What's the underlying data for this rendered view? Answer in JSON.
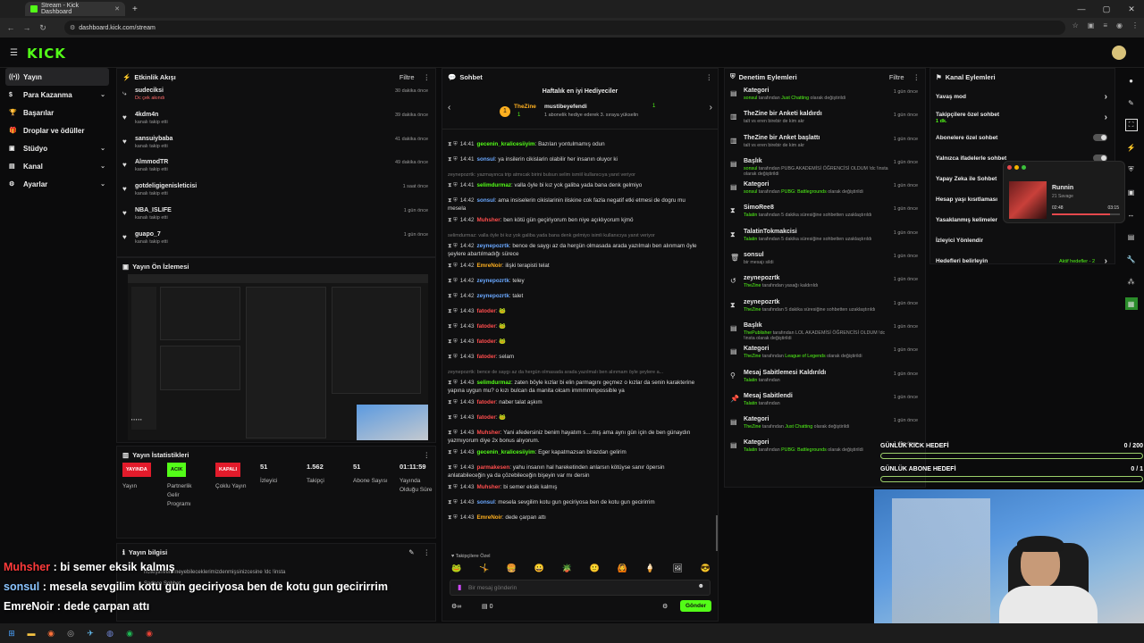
{
  "browser": {
    "tab_title": "Stream - Kick Dashboard",
    "new_tab": "+",
    "url": "dashboard.kick.com/stream"
  },
  "brand": {
    "logo": "KICK"
  },
  "sidebar": {
    "items": [
      {
        "label": "Yayın",
        "icon": "broadcast-icon",
        "chev": ""
      },
      {
        "label": "Para Kazanma",
        "icon": "money-icon",
        "chev": "⌄"
      },
      {
        "label": "Başarılar",
        "icon": "trophy-icon",
        "chev": ""
      },
      {
        "label": "Droplar ve ödüller",
        "icon": "gift-icon",
        "chev": ""
      },
      {
        "label": "Stüdyo",
        "icon": "studio-icon",
        "chev": "⌄"
      },
      {
        "label": "Kanal",
        "icon": "channel-icon",
        "chev": "⌄"
      },
      {
        "label": "Ayarlar",
        "icon": "settings-icon",
        "chev": "⌄"
      }
    ]
  },
  "activity": {
    "title": "Etkinlik Akışı",
    "filter": "Filtre",
    "items": [
      {
        "name": "sudeciksi",
        "sub": "Dc çek akındı",
        "time": "30 dakika önce",
        "icon": "share-icon"
      },
      {
        "name": "4kdm4n",
        "sub": "kanalı takip etti",
        "time": "39 dakika önce",
        "icon": "heart-icon"
      },
      {
        "name": "sansuiybaba",
        "sub": "kanalı takip etti",
        "time": "41 dakika önce",
        "icon": "heart-icon"
      },
      {
        "name": "AlmmodTR",
        "sub": "kanalı takip etti",
        "time": "49 dakika önce",
        "icon": "heart-icon"
      },
      {
        "name": "gotdeligigenisleticisi",
        "sub": "kanalı takip etti",
        "time": "1 saat önce",
        "icon": "heart-icon"
      },
      {
        "name": "NBA_ISLIFE",
        "sub": "kanalı takip etti",
        "time": "1 gün önce",
        "icon": "heart-icon"
      },
      {
        "name": "guapo_7",
        "sub": "kanalı takip etti",
        "time": "1 gün önce",
        "icon": "heart-icon"
      }
    ]
  },
  "preview": {
    "title": "Yayın Ön İzlemesi"
  },
  "stats": {
    "title": "Yayın İstatistikleri",
    "yayin_badge": "YAYINDA",
    "yayin_label": "Yayın",
    "partner_badge": "ACIK",
    "partner_label": "Partnerlik Gelir Programı",
    "multi_badge": "KAPALI",
    "multi_label": "Çoklu Yayın",
    "viewers": "51",
    "viewers_label": "İzleyici",
    "followers": "1.562",
    "followers_label": "Takipçi",
    "subs": "51",
    "subs_label": "Abone Sayısı",
    "uptime": "01:11:59",
    "uptime_label": "Yayında Olduğu Süre"
  },
  "info": {
    "title": "Yayın bilgisi"
  },
  "chat": {
    "title": "Sohbet",
    "gifters_title": "Haftalık en iyi Hediyeciler",
    "g1_name": "TheZine",
    "g1_count": "1",
    "g2_name": "mustibeyefendi",
    "g2_count": "1",
    "g2_note": "1 abonelik hediye ederek 3. sıraya yükselin",
    "input_placeholder": "Bir mesaj gönderin",
    "send": "Gönder",
    "followers_only": "Takipçilere Özel",
    "points": "0",
    "lines": [
      {
        "t": "14:41",
        "u": "gecenin_kralicesiiyim",
        "uc": "#53fc18",
        "m": ": Bazıları yontulmamış odun",
        "d": ""
      },
      {
        "t": "14:41",
        "u": "sonsul",
        "uc": "#6aa8ff",
        "m": ": ya insilerin cikislarin olabilir her insanın oluyor ki",
        "d": ""
      },
      {
        "t": "",
        "u": "",
        "uc": "",
        "m": "",
        "d": "zeynepozrtk: yazmayınca trip atmıcak birini bulsun selim ismiil kullanıcıya yanıt veriyor"
      },
      {
        "t": "14:41",
        "u": "selimdurmaz",
        "uc": "#53fc18",
        "m": ": valla öyle bi kız yok galiba yada bana denk gelmiyo",
        "d": ""
      },
      {
        "t": "14:42",
        "u": "sonsul",
        "uc": "#6aa8ff",
        "m": ": ama insiselerin cikislarinin iliskine cok fazla negatif etki etmesi de dogru mu mesela",
        "d": ""
      },
      {
        "t": "14:42",
        "u": "Muhsher",
        "uc": "#ff4d4d",
        "m": ": ben kötü gün geçiriyorum ben niye açıklıyorum kjmö",
        "d": ""
      },
      {
        "t": "",
        "u": "",
        "uc": "",
        "m": "",
        "d": "selimdurmaz: valla öyle bi kız yok galiba yada bana denk gelmiyo isimli kullanıcıya yanıt veriyor"
      },
      {
        "t": "14:42",
        "u": "zeynepozrtk",
        "uc": "#6aa8ff",
        "m": ": bence de saygı az da hergün olmasada arada yazılmalı ben alınmam öyle şeylere abartılmadığı sürece",
        "d": ""
      },
      {
        "t": "14:42",
        "u": "EmreNoir",
        "uc": "#ffb020",
        "m": ": ilişki terapisti telat",
        "d": ""
      },
      {
        "t": "14:42",
        "u": "zeynepozrtk",
        "uc": "#6aa8ff",
        "m": ": teley",
        "d": ""
      },
      {
        "t": "14:42",
        "u": "zeynepozrtk",
        "uc": "#6aa8ff",
        "m": ": talet",
        "d": ""
      },
      {
        "t": "14:43",
        "u": "fatoder",
        "uc": "#ff4d4d",
        "m": ": 🐸",
        "d": ""
      },
      {
        "t": "14:43",
        "u": "fatoder",
        "uc": "#ff4d4d",
        "m": ": 🐸",
        "d": ""
      },
      {
        "t": "14:43",
        "u": "fatoder",
        "uc": "#ff4d4d",
        "m": ": 🐸",
        "d": ""
      },
      {
        "t": "14:43",
        "u": "fatoder",
        "uc": "#ff4d4d",
        "m": ": selam",
        "d": ""
      },
      {
        "t": "",
        "u": "",
        "uc": "",
        "m": "",
        "d": "zeynepozrtk: bence de saygı az da hergün olmasada arada yazılmalı ben alınmam öyle şeylere a..."
      },
      {
        "t": "14:43",
        "u": "selimdurmaz",
        "uc": "#53fc18",
        "m": ": zaten böyle kızlar bi elin parmagını geçmez o kızlar da senin karakterine yapına uygun mu? o kızı bulcan da manita olcam immmmmpossible ya",
        "d": ""
      },
      {
        "t": "14:43",
        "u": "fatoder",
        "uc": "#ff4d4d",
        "m": ": naber talat aşkım",
        "d": ""
      },
      {
        "t": "14:43",
        "u": "fatoder",
        "uc": "#ff4d4d",
        "m": ": 🐸",
        "d": ""
      },
      {
        "t": "14:43",
        "u": "Muhsher",
        "uc": "#ff4d4d",
        "m": ": Yani afedersiniz benim hayatım s....mış ama aynı gün için de ben günaydın yazmıyorum diye 2x bonus alıyorum.",
        "d": ""
      },
      {
        "t": "14:43",
        "u": "gecenin_kralicesiiyim",
        "uc": "#53fc18",
        "m": ": Eger kapatmazsan birazdan gelirim",
        "d": ""
      },
      {
        "t": "14:43",
        "u": "parmakesen",
        "uc": "#ff4d4d",
        "m": ": yahu insanın hal hareketinden anlarsın kötüyse sanır öpersin anlatabileceğin ya da çözebileceğin bişeyin var mı dersin",
        "d": ""
      },
      {
        "t": "14:43",
        "u": "Muhsher",
        "uc": "#ff4d4d",
        "m": ": bi semer eksik kalmış",
        "d": ""
      },
      {
        "t": "14:43",
        "u": "sonsul",
        "uc": "#6aa8ff",
        "m": ": mesela sevgilim kotu gun geciriyosa ben de kotu gun gecirirrim",
        "d": ""
      },
      {
        "t": "14:43",
        "u": "EmreNoir",
        "uc": "#ffb020",
        "m": ": dede çarpan attı",
        "d": ""
      }
    ]
  },
  "mod": {
    "title": "Denetim Eylemleri",
    "filter": "Filtre",
    "items": [
      {
        "name": "Kategori",
        "sub1": "sonsul",
        "sub2": " tarafından ",
        "hl": "Just Chatting",
        "sub3": " olarak değiştirildi",
        "time": "1 gün önce",
        "icon": "category-icon"
      },
      {
        "name": "TheZine bir Anketi kaldırdı",
        "sub1": "",
        "sub2": "talt vs eren birebir de kim akr",
        "hl": "",
        "sub3": "",
        "time": "1 gün önce",
        "icon": "poll-icon"
      },
      {
        "name": "TheZine bir Anket başlattı",
        "sub1": "",
        "sub2": "talt vs eren birebir de kim akr",
        "hl": "",
        "sub3": "",
        "time": "1 gün önce",
        "icon": "poll-icon"
      },
      {
        "name": "Başlık",
        "sub1": "sonsul",
        "sub2": " tarafından PUBG AKADEMİSİ ÖĞRENCİSİ OLDUM !dc !insta olarak değiştirildi",
        "hl": "",
        "sub3": "",
        "time": "1 gün önce",
        "icon": "title-icon"
      },
      {
        "name": "Kategori",
        "sub1": "sonsul",
        "sub2": " tarafından ",
        "hl": "PUBG: Battlegrounds",
        "sub3": " olarak değiştirildi",
        "time": "1 gün önce",
        "icon": "category-icon"
      },
      {
        "name": "SimoRee8",
        "sub1": "Talatin",
        "sub2": " tarafından 5 dakika süresiğine sohbetten uzaklaştırıldı",
        "hl": "",
        "sub3": "",
        "time": "1 gün önce",
        "icon": "timeout-icon"
      },
      {
        "name": "TalatinTokmakcisi",
        "sub1": "Talatin",
        "sub2": " tarafından 5 dakika süresiğine sohbetten uzaklaştırıldı",
        "hl": "",
        "sub3": "",
        "time": "1 gün önce",
        "icon": "timeout-icon"
      },
      {
        "name": "sonsul",
        "sub1": "",
        "sub2": "bir mesajı sildi",
        "hl": "",
        "sub3": "",
        "time": "1 gün önce",
        "icon": "trash-icon"
      },
      {
        "name": "zeynepozrtk",
        "sub1": "TheZine",
        "sub2": " tarafından yasağı kaldırıldı",
        "hl": "",
        "sub3": "",
        "time": "1 gün önce",
        "icon": "unban-icon"
      },
      {
        "name": "zeynepozrtk",
        "sub1": "TheZine",
        "sub2": " tarafından 5 dakika süresiğine sohbetten uzaklaştırıldı",
        "hl": "",
        "sub3": "",
        "time": "1 gün önce",
        "icon": "timeout-icon"
      },
      {
        "name": "Başlık",
        "sub1": "ThePublisher",
        "sub2": " tarafından LOL AKADEMİSİ ÖĞRENCİSİ OLDUM !dc !insta olarak değiştirildi",
        "hl": "",
        "sub3": "",
        "time": "1 gün önce",
        "icon": "title-icon"
      },
      {
        "name": "Kategori",
        "sub1": "TheZine",
        "sub2": " tarafından ",
        "hl": "League of Legends",
        "sub3": " olarak değiştirildi",
        "time": "1 gün önce",
        "icon": "category-icon"
      },
      {
        "name": "Mesaj Sabitlemesi Kaldırıldı",
        "sub1": "Talatin",
        "sub2": " tarafından",
        "hl": "",
        "sub3": "",
        "time": "1 gün önce",
        "icon": "unpin-icon"
      },
      {
        "name": "Mesaj Sabitlendi",
        "sub1": "Talatin",
        "sub2": " tarafından",
        "hl": "",
        "sub3": "",
        "time": "1 gün önce",
        "icon": "pin-icon"
      },
      {
        "name": "Kategori",
        "sub1": "TheZine",
        "sub2": " tarafından ",
        "hl": "Just Chatting",
        "sub3": " olarak değiştirildi",
        "time": "1 gün önce",
        "icon": "category-icon"
      },
      {
        "name": "Kategori",
        "sub1": "Talatin",
        "sub2": " tarafından ",
        "hl": "PUBG: Battlegrounds",
        "sub3": " olarak değiştirildi",
        "time": "1 gün önce",
        "icon": "category-icon"
      }
    ]
  },
  "kanal": {
    "title": "Kanal Eylemleri",
    "items": [
      {
        "label": "Yavaş mod",
        "ctl": "chevron"
      },
      {
        "label": "Takipçilere özel sohbet",
        "sub": "1 dk.",
        "ctl": "chevron"
      },
      {
        "label": "Abonelere özel sohbet",
        "ctl": "toggle"
      },
      {
        "label": "Yalnızca ifadelerle sohbet",
        "ctl": "toggle"
      },
      {
        "label": "Yapay Zeka ile Sohbet",
        "ctl": "none"
      },
      {
        "label": "Hesap yaşı kısıtlaması",
        "ctl": "none"
      },
      {
        "label": "Yasaklanmış kelimeler",
        "ctl": "none"
      },
      {
        "label": "İzleyici Yönlendir",
        "ctl": "none"
      },
      {
        "label": "Hedefleri belirleyin",
        "ctl": "chevron",
        "note": "Aktif hedefler - 2"
      }
    ]
  },
  "music": {
    "title": "Runnin",
    "artist": "21 Savage",
    "elapsed": "02:48",
    "total": "03:15",
    "progress": 0.86
  },
  "goals": [
    {
      "label": "GÜNLÜK KICK HEDEFİ",
      "value": "0 / 200",
      "progress": 0
    },
    {
      "label": "GÜNLÜK ABONE HEDEFİ",
      "value": "0 / 1",
      "progress": 0
    }
  ],
  "overlay": [
    {
      "user": "Muhsher",
      "msg": " : bi semer eksik kalmış",
      "color": "#ff3b3b"
    },
    {
      "user": "sonsul",
      "msg": " : mesela sevgilim kotu gun geciriyosa ben de kotu gun gecirirrim",
      "color": "#8ac4ff"
    },
    {
      "user": "EmreNoir",
      "msg": " : dede çarpan attı",
      "color": "#ffffff"
    }
  ],
  "overlay_under": {
    "line1": "ricileştiriveremeyebileceklerimizdenmişsinizcesine !dc !insta",
    "line2": "Sadece Sohbet"
  },
  "colors": {
    "accent": "#53fc18",
    "danger": "#e21b2b"
  }
}
